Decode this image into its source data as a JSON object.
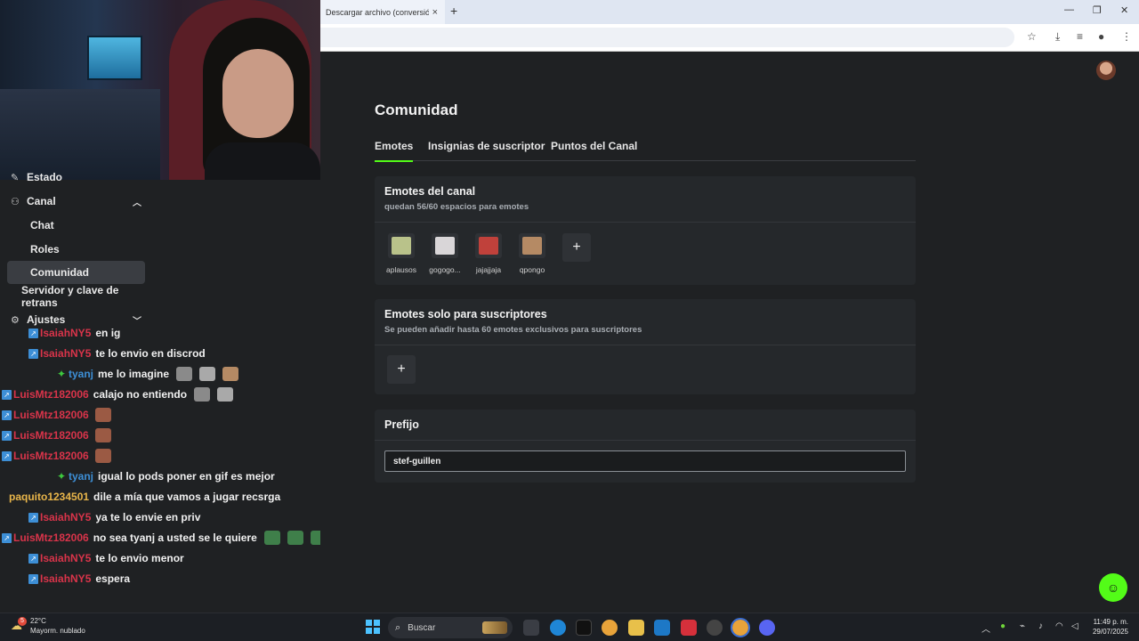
{
  "browser": {
    "tab_title": "Descargar archivo (conversión",
    "tab_close": "×",
    "new_tab": "+",
    "controls": {
      "minimize": "—",
      "restore": "❐",
      "close": "✕"
    },
    "toolbar_icons": [
      "star-icon",
      "download-icon",
      "media-icon",
      "extension-icon",
      "menu-icon"
    ]
  },
  "sidebar": {
    "partial_item": "Estado",
    "items": [
      {
        "label": "Canal",
        "icon": "channel-icon",
        "expanded": true
      },
      {
        "label": "Chat"
      },
      {
        "label": "Roles"
      },
      {
        "label": "Comunidad",
        "active": true
      },
      {
        "label": "Servidor y clave de retrans"
      },
      {
        "label": "Ajustes",
        "icon": "gear-icon",
        "expanded": false
      }
    ]
  },
  "chat": {
    "messages": [
      {
        "user": "IsaiahNY5",
        "color": "#d9344a",
        "badge": "blue",
        "text": "en ig",
        "emotes": 0
      },
      {
        "user": "IsaiahNY5",
        "color": "#d9344a",
        "badge": "blue",
        "text": "te lo envio en discrod",
        "emotes": 0
      },
      {
        "user": "tyanj",
        "color": "#3d8fd6",
        "badge": "green",
        "text": "me lo imagine",
        "emotes": 3
      },
      {
        "user": "LuisMtz182006",
        "color": "#d9344a",
        "badge": "blue",
        "text": "calajo no entiendo",
        "emotes": 2
      },
      {
        "user": "LuisMtz182006",
        "color": "#d9344a",
        "badge": "blue",
        "text": "",
        "emotes": 1
      },
      {
        "user": "LuisMtz182006",
        "color": "#d9344a",
        "badge": "blue",
        "text": "",
        "emotes": 1
      },
      {
        "user": "LuisMtz182006",
        "color": "#d9344a",
        "badge": "blue",
        "text": "",
        "emotes": 1
      },
      {
        "user": "tyanj",
        "color": "#3d8fd6",
        "badge": "green",
        "text": "igual lo pods poner en gif es mejor",
        "emotes": 0
      },
      {
        "user": "paquito1234501",
        "color": "#e8b54a",
        "badge": "none",
        "text": "dile a mía que vamos a jugar recsrga",
        "emotes": 0
      },
      {
        "user": "IsaiahNY5",
        "color": "#d9344a",
        "badge": "blue",
        "text": "ya te lo envie en priv",
        "emotes": 0
      },
      {
        "user": "LuisMtz182006",
        "color": "#d9344a",
        "badge": "blue",
        "text": "no sea tyanj a usted se le quiere",
        "emotes": 3
      },
      {
        "user": "IsaiahNY5",
        "color": "#d9344a",
        "badge": "blue",
        "text": "te lo envio menor",
        "emotes": 0
      },
      {
        "user": "IsaiahNY5",
        "color": "#d9344a",
        "badge": "blue",
        "text": "espera",
        "emotes": 0
      }
    ]
  },
  "main": {
    "title": "Comunidad",
    "tabs": [
      {
        "label": "Emotes",
        "active": true
      },
      {
        "label": "Insignias de suscriptor"
      },
      {
        "label": "Puntos del Canal"
      }
    ],
    "channel_emotes": {
      "title": "Emotes del canal",
      "subtitle": "quedan 56/60 espacios para emotes",
      "emotes": [
        {
          "name": "aplausos",
          "color": "#b9c28a"
        },
        {
          "name": "gogogo...",
          "color": "#d9d6d8"
        },
        {
          "name": "jajajjaja",
          "color": "#c0413b"
        },
        {
          "name": "qpongo",
          "color": "#b58a64"
        }
      ],
      "add": "+"
    },
    "sub_emotes": {
      "title": "Emotes solo para suscriptores",
      "subtitle": "Se pueden añadir hasta 60 emotes exclusivos para suscriptores",
      "add": "+"
    },
    "prefix": {
      "title": "Prefijo",
      "value": "stef-guillen"
    },
    "accent": "#53fc18"
  },
  "taskbar": {
    "weather_temp": "22°C",
    "weather_desc": "Mayorm. nublado",
    "weather_badge": "5",
    "search_placeholder": "Buscar",
    "time": "11:49 p. m.",
    "date": "29/07/2025"
  }
}
